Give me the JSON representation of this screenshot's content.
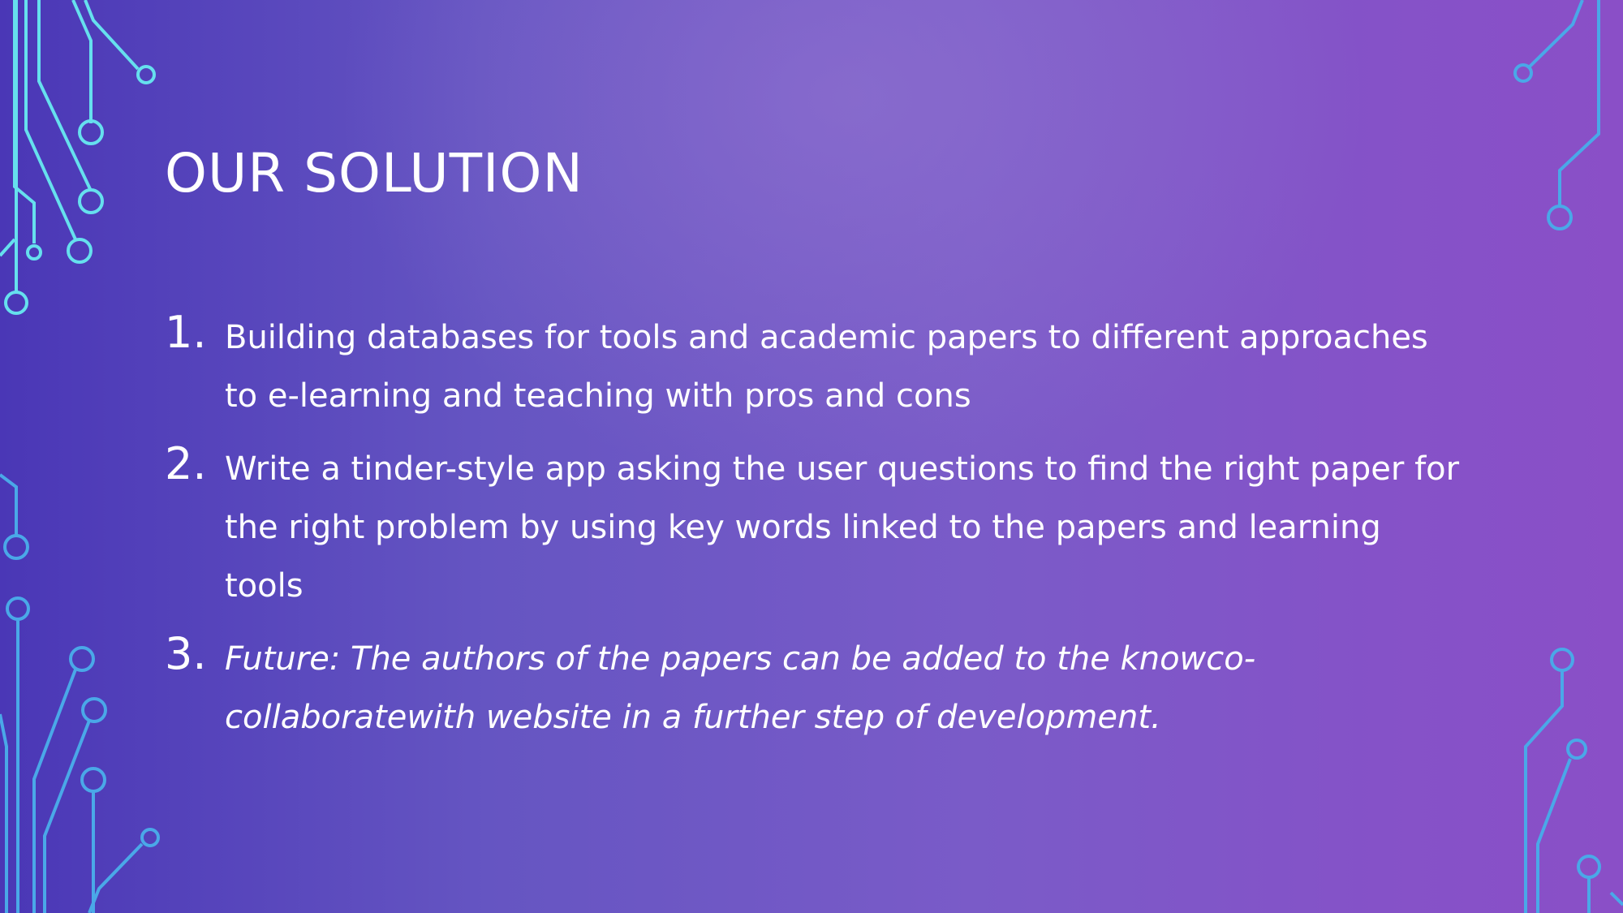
{
  "slide": {
    "title": "OUR SOLUTION",
    "items": [
      {
        "number": "1.",
        "text": "Building databases for tools and academic papers to different approaches to e-learning and teaching with pros and cons"
      },
      {
        "number": "2.",
        "text": "Write a tinder-style app asking the user questions to find the right paper for the right problem by using key words linked to the papers and learning tools"
      },
      {
        "number": "3.",
        "text": "Future: The authors of  the papers can be added to the knowco-collaboratewith website in a further step of  development.",
        "italic": true
      }
    ]
  },
  "colors": {
    "background_left": "#4a37b6",
    "background_right": "#8a4fc7",
    "circuit_cyan": "#66e0ee",
    "circuit_blue": "#4aa8e8",
    "text": "#ffffff"
  },
  "decorations": {
    "left_circuit_icon": "circuit-lines-icon",
    "right_circuit_icon": "circuit-lines-icon"
  }
}
